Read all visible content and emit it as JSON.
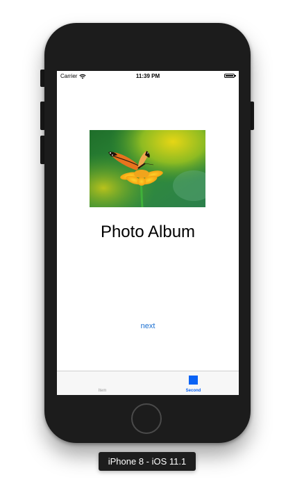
{
  "status_bar": {
    "carrier": "Carrier",
    "wifi_icon": "wifi-icon",
    "time": "11:39 PM",
    "battery_icon": "battery-icon",
    "battery_level": 1.0
  },
  "main": {
    "image_description_icon": "butterfly-photo",
    "title": "Photo Album",
    "next_link": "next",
    "link_color": "#1a6fd1"
  },
  "tab_bar": {
    "items": [
      {
        "label": "Item",
        "icon": "blank-tab-icon",
        "selected": false
      },
      {
        "label": "Second",
        "icon": "square-tab-icon",
        "selected": true
      }
    ],
    "accent_color": "#0a63f5"
  },
  "simulator": {
    "device_label": "iPhone 8 - iOS 11.1"
  }
}
